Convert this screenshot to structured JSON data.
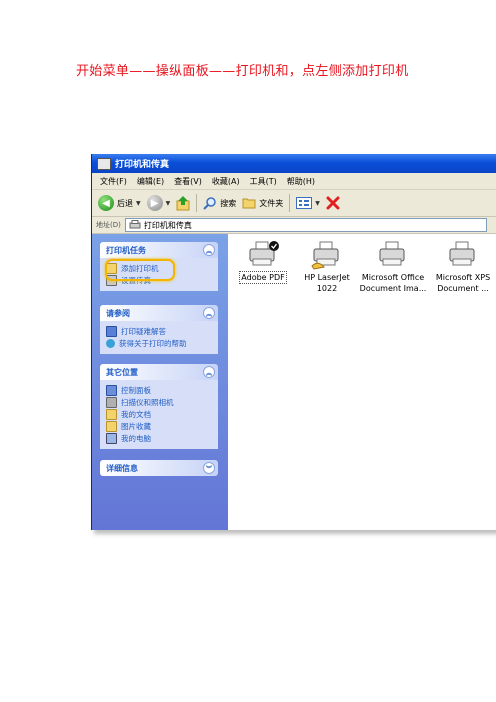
{
  "instruction_text": "开始菜单——操纵面板——打印机和，点左侧添加打印机",
  "window": {
    "title": "打印机和传真",
    "menu": [
      "文件(F)",
      "编辑(E)",
      "查看(V)",
      "收藏(A)",
      "工具(T)",
      "帮助(H)"
    ],
    "toolbar": {
      "back": "后退",
      "search": "搜索",
      "folders": "文件夹"
    },
    "address": {
      "label": "地址(D)",
      "value": "打印机和传真"
    }
  },
  "left_pane": {
    "tasks": {
      "title": "打印机任务",
      "items": [
        "添加打印机",
        "设置传真"
      ]
    },
    "see_also": {
      "title": "请参阅",
      "items": [
        "打印疑难解答",
        "获得关于打印的帮助"
      ]
    },
    "other_places": {
      "title": "其它位置",
      "items": [
        "控制面板",
        "扫描仪和照相机",
        "我的文档",
        "图片收藏",
        "我的电脑"
      ]
    },
    "details": {
      "title": "详细信息"
    }
  },
  "printers": [
    {
      "line1": "Adobe PDF",
      "line2": ""
    },
    {
      "line1": "HP LaserJet",
      "line2": "1022"
    },
    {
      "line1": "Microsoft Office",
      "line2": "Document Ima..."
    },
    {
      "line1": "Microsoft XPS",
      "line2": "Document ..."
    }
  ],
  "colors": {
    "instruction": "#e8141e",
    "highlight": "#f5b400",
    "xp_blue": "#0a4fd8"
  }
}
